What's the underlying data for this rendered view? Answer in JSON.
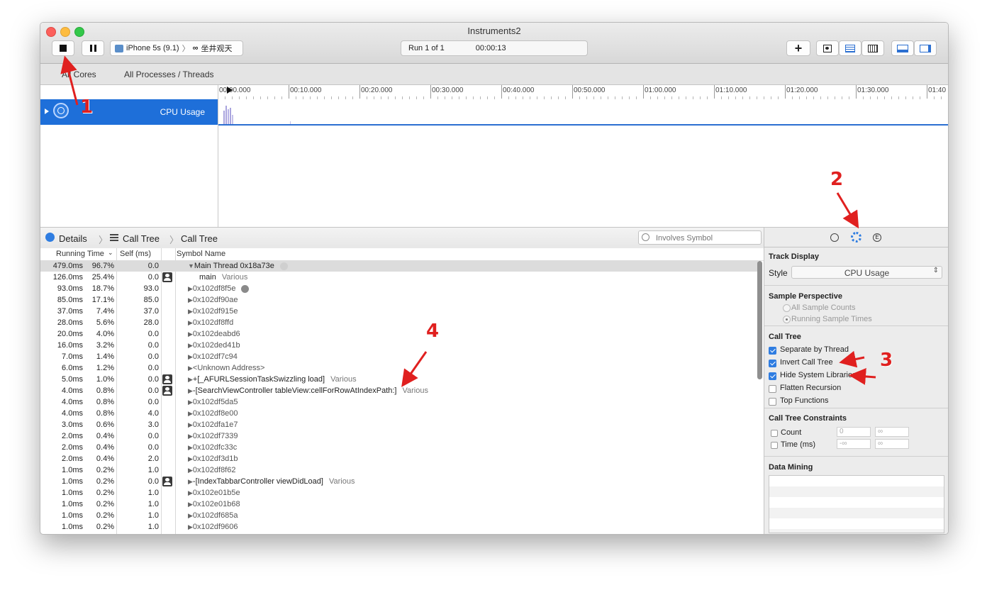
{
  "window": {
    "title": "Instruments2",
    "device_label": "iPhone 5s (9.1)",
    "app_label": "坐井观天",
    "run_label": "Run 1 of 1",
    "elapsed": "00:00:13"
  },
  "scope": {
    "cores": "All Cores",
    "processes": "All Processes / Threads"
  },
  "ruler": [
    "00:00.000",
    "00:10.000",
    "00:20.000",
    "00:30.000",
    "00:40.000",
    "00:50.000",
    "01:00.000",
    "01:10.000",
    "01:20.000",
    "01:30.000",
    "01:40"
  ],
  "track": {
    "label": "CPU Usage"
  },
  "details": {
    "breadcrumb": [
      "Details",
      "Call Tree",
      "Call Tree"
    ],
    "search_placeholder": "Involves Symbol"
  },
  "columns": {
    "running_time": "Running Time",
    "self": "Self (ms)",
    "symbol": "Symbol Name"
  },
  "rows": [
    {
      "rt": "479.0ms",
      "pct": "96.7%",
      "self": "0.0",
      "sym": "Main Thread  0x18a73e",
      "kind": "main"
    },
    {
      "rt": "126.0ms",
      "pct": "25.4%",
      "self": "0.0",
      "sym": "main",
      "various": "Various",
      "user": true
    },
    {
      "rt": "93.0ms",
      "pct": "18.7%",
      "self": "93.0",
      "sym": "0x102df8f5e",
      "kind": "lib"
    },
    {
      "rt": "85.0ms",
      "pct": "17.1%",
      "self": "85.0",
      "sym": "0x102df90ae",
      "kind": "lib"
    },
    {
      "rt": "37.0ms",
      "pct": "7.4%",
      "self": "37.0",
      "sym": "0x102df915e",
      "kind": "lib"
    },
    {
      "rt": "28.0ms",
      "pct": "5.6%",
      "self": "28.0",
      "sym": "0x102df8ffd",
      "kind": "lib"
    },
    {
      "rt": "20.0ms",
      "pct": "4.0%",
      "self": "0.0",
      "sym": "0x102deabd6",
      "kind": "lib"
    },
    {
      "rt": "16.0ms",
      "pct": "3.2%",
      "self": "0.0",
      "sym": "0x102ded41b",
      "kind": "lib"
    },
    {
      "rt": "7.0ms",
      "pct": "1.4%",
      "self": "0.0",
      "sym": "0x102df7c94",
      "kind": "lib"
    },
    {
      "rt": "6.0ms",
      "pct": "1.2%",
      "self": "0.0",
      "sym": "<Unknown Address>",
      "kind": "lib"
    },
    {
      "rt": "5.0ms",
      "pct": "1.0%",
      "self": "0.0",
      "sym": "+[_AFURLSessionTaskSwizzling load]",
      "various": "Various",
      "user": true
    },
    {
      "rt": "4.0ms",
      "pct": "0.8%",
      "self": "0.0",
      "sym": "-[SearchViewController tableView:cellForRowAtIndexPath:]",
      "various": "Various",
      "user": true
    },
    {
      "rt": "4.0ms",
      "pct": "0.8%",
      "self": "0.0",
      "sym": "0x102df5da5",
      "kind": "lib"
    },
    {
      "rt": "4.0ms",
      "pct": "0.8%",
      "self": "4.0",
      "sym": "0x102df8e00",
      "kind": "lib"
    },
    {
      "rt": "3.0ms",
      "pct": "0.6%",
      "self": "3.0",
      "sym": "0x102dfa1e7",
      "kind": "lib"
    },
    {
      "rt": "2.0ms",
      "pct": "0.4%",
      "self": "0.0",
      "sym": "0x102df7339",
      "kind": "lib"
    },
    {
      "rt": "2.0ms",
      "pct": "0.4%",
      "self": "0.0",
      "sym": "0x102dfc33c",
      "kind": "lib"
    },
    {
      "rt": "2.0ms",
      "pct": "0.4%",
      "self": "2.0",
      "sym": "0x102df3d1b",
      "kind": "lib"
    },
    {
      "rt": "1.0ms",
      "pct": "0.2%",
      "self": "1.0",
      "sym": "0x102df8f62",
      "kind": "lib"
    },
    {
      "rt": "1.0ms",
      "pct": "0.2%",
      "self": "0.0",
      "sym": "-[IndexTabbarController viewDidLoad]",
      "various": "Various",
      "user": true
    },
    {
      "rt": "1.0ms",
      "pct": "0.2%",
      "self": "1.0",
      "sym": "0x102e01b5e",
      "kind": "lib"
    },
    {
      "rt": "1.0ms",
      "pct": "0.2%",
      "self": "1.0",
      "sym": "0x102e01b68",
      "kind": "lib"
    },
    {
      "rt": "1.0ms",
      "pct": "0.2%",
      "self": "1.0",
      "sym": "0x102df685a",
      "kind": "lib"
    },
    {
      "rt": "1.0ms",
      "pct": "0.2%",
      "self": "1.0",
      "sym": "0x102df9606",
      "kind": "lib"
    }
  ],
  "inspector": {
    "track_display": "Track Display",
    "style_label": "Style",
    "style_value": "CPU Usage",
    "sample_perspective": "Sample Perspective",
    "all_sample_counts": "All Sample Counts",
    "running_sample_times": "Running Sample Times",
    "call_tree": "Call Tree",
    "options": [
      {
        "label": "Separate by Thread",
        "checked": true
      },
      {
        "label": "Invert Call Tree",
        "checked": true
      },
      {
        "label": "Hide System Libraries",
        "checked": true
      },
      {
        "label": "Flatten Recursion",
        "checked": false
      },
      {
        "label": "Top Functions",
        "checked": false
      }
    ],
    "constraints": "Call Tree Constraints",
    "count_label": "Count",
    "count_min": "0",
    "count_max": "∞",
    "time_label": "Time (ms)",
    "time_min": "-∞",
    "time_max": "∞",
    "data_mining": "Data Mining"
  },
  "annotations": [
    "1",
    "2",
    "3",
    "4"
  ],
  "colors": {
    "accent": "#1e6fd9",
    "annotation": "#e0201f"
  }
}
